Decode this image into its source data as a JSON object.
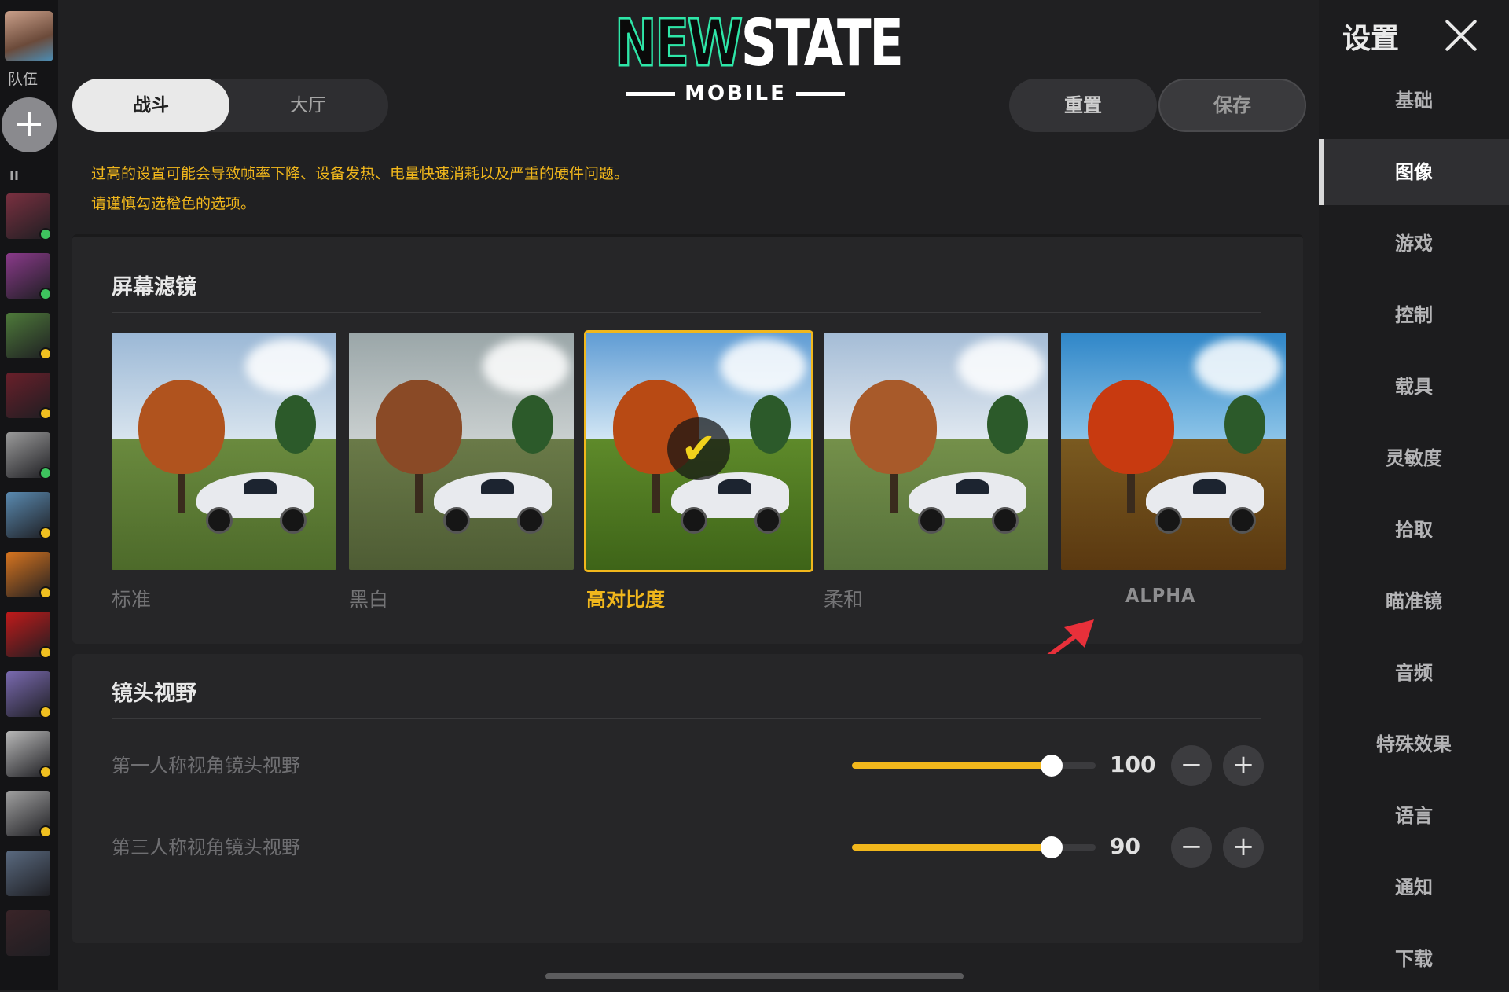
{
  "left_column": {
    "team_label": "队伍",
    "add_icon": "plus-icon",
    "pause_icon": "pause-icon",
    "friends": [
      {
        "color": "#7a3040",
        "status": "green"
      },
      {
        "color": "#8a3a8a",
        "status": "green"
      },
      {
        "color": "#4e7a3a",
        "status": "yellow"
      },
      {
        "color": "#6a1f2a",
        "status": "yellow"
      },
      {
        "color": "#9a9a9a",
        "status": "green"
      },
      {
        "color": "#5a8ab0",
        "status": "yellow"
      },
      {
        "color": "#d8751f",
        "status": "yellow"
      },
      {
        "color": "#c21a1a",
        "status": "yellow"
      },
      {
        "color": "#7a6ab0",
        "status": "yellow"
      },
      {
        "color": "#b8b8b8",
        "status": "yellow"
      },
      {
        "color": "#a0a0a0",
        "status": "yellow"
      },
      {
        "color": "#5a6a80",
        "status": "none"
      },
      {
        "color": "#3a2428",
        "status": "none"
      }
    ]
  },
  "logo": {
    "main_new": "NEW",
    "main_state": "STATE",
    "sub": "MOBILE"
  },
  "tabs": [
    {
      "label": "战斗",
      "active": true
    },
    {
      "label": "大厅",
      "active": false
    }
  ],
  "actions": {
    "reset": "重置",
    "save": "保存"
  },
  "warning": {
    "line1": "过高的设置可能会导致帧率下降、设备发热、电量快速消耗以及严重的硬件问题。",
    "line2": "请谨慎勾选橙色的选项。"
  },
  "screen_filter": {
    "title": "屏幕滤镜",
    "options": [
      {
        "label": "标准",
        "selected": false,
        "tone": "standard"
      },
      {
        "label": "黑白",
        "selected": false,
        "tone": "muted"
      },
      {
        "label": "高对比度",
        "selected": true,
        "tone": "contrast"
      },
      {
        "label": "柔和",
        "selected": false,
        "tone": "soft"
      },
      {
        "label": "ALPHA",
        "selected": false,
        "tone": "alpha"
      }
    ],
    "check_icon": "checkmark-icon"
  },
  "fov": {
    "title": "镜头视野",
    "sliders": [
      {
        "label": "第一人称视角镜头视野",
        "value": "100",
        "fill_fraction": 0.82
      },
      {
        "label": "第三人称视角镜头视野",
        "value": "90",
        "fill_fraction": 0.82
      }
    ],
    "minus": "−",
    "plus": "+"
  },
  "sidebar": {
    "title": "设置",
    "close_icon": "close-icon",
    "items": [
      {
        "label": "基础",
        "active": false
      },
      {
        "label": "图像",
        "active": true
      },
      {
        "label": "游戏",
        "active": false
      },
      {
        "label": "控制",
        "active": false
      },
      {
        "label": "载具",
        "active": false
      },
      {
        "label": "灵敏度",
        "active": false
      },
      {
        "label": "拾取",
        "active": false
      },
      {
        "label": "瞄准镜",
        "active": false
      },
      {
        "label": "音频",
        "active": false
      },
      {
        "label": "特殊效果",
        "active": false
      },
      {
        "label": "语言",
        "active": false
      },
      {
        "label": "通知",
        "active": false
      },
      {
        "label": "下载",
        "active": false
      }
    ]
  },
  "colors": {
    "accent": "#f1b71c",
    "logo_green": "#2ee6a8",
    "annotation_arrow": "#e8303a"
  }
}
